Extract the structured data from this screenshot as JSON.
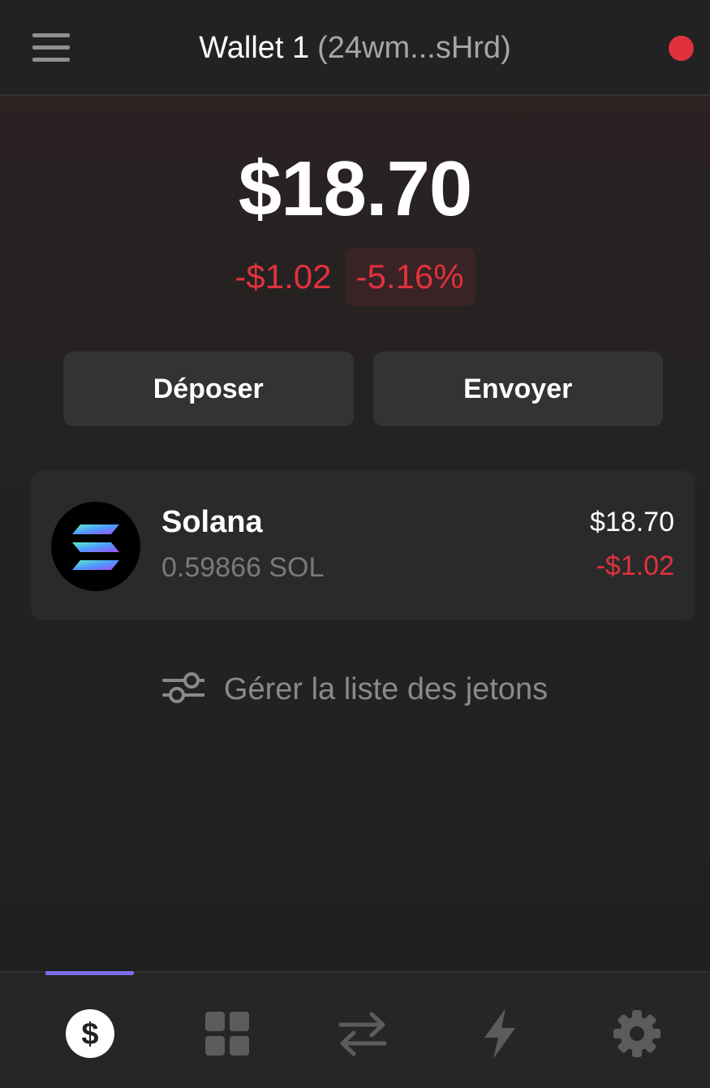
{
  "header": {
    "wallet_name": "Wallet 1",
    "wallet_address": "(24wm...sHrd)",
    "status_color": "#e0323e",
    "menu_icon": "hamburger-menu-icon"
  },
  "balance": {
    "total": "$18.70",
    "change_amount": "-$1.02",
    "change_percent": "-5.16%"
  },
  "actions": {
    "deposit_label": "Déposer",
    "send_label": "Envoyer"
  },
  "tokens": [
    {
      "name": "Solana",
      "amount": "0.59866 SOL",
      "value": "$18.70",
      "change": "-$1.02",
      "icon": "solana-logo-icon"
    }
  ],
  "manage": {
    "label": "Gérer la liste des jetons",
    "icon": "sliders-icon"
  },
  "tabbar": {
    "active_index": 0,
    "accent_color": "#7a6ff0",
    "tabs": [
      {
        "icon": "dollar-icon"
      },
      {
        "icon": "grid-icon"
      },
      {
        "icon": "swap-arrows-icon"
      },
      {
        "icon": "lightning-icon"
      },
      {
        "icon": "gear-icon"
      }
    ]
  },
  "colors": {
    "background": "#222222",
    "negative": "#e0323e",
    "button": "#333333",
    "card": "#2a2a2a"
  }
}
